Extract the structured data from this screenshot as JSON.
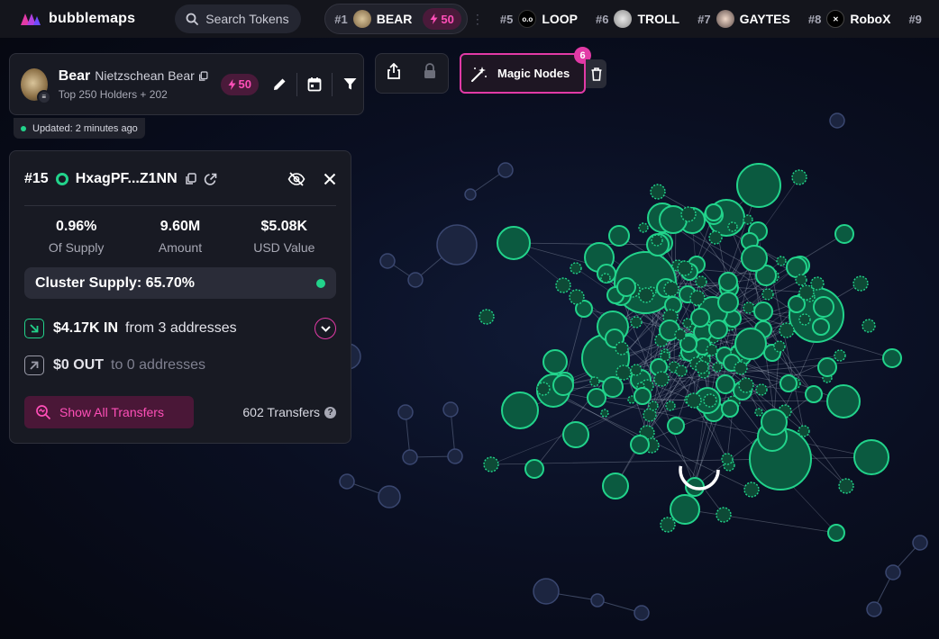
{
  "app": {
    "brand_name": "bubblemaps",
    "accent_color": "#e23aa6",
    "node_color": "#22d38b"
  },
  "search": {
    "label": "Search Tokens",
    "icon": "search-icon"
  },
  "tokens": [
    {
      "rank": "#1",
      "name": "BEAR",
      "bolt": "50",
      "active": true
    },
    {
      "rank": "#5",
      "name": "LOOP"
    },
    {
      "rank": "#6",
      "name": "TROLL"
    },
    {
      "rank": "#7",
      "name": "GAYTES"
    },
    {
      "rank": "#8",
      "name": "RoboX"
    },
    {
      "rank": "#9",
      "name": ""
    }
  ],
  "token_card": {
    "name": "Bear",
    "full_name": "Nietzschean Bear",
    "subtitle": "Top 250 Holders + 202",
    "bolt": "50",
    "updated": "Updated: 2 minutes ago"
  },
  "magic": {
    "label": "Magic Nodes",
    "count": "6"
  },
  "panel": {
    "rank": "#15",
    "address": "HxagPF...Z1NN",
    "stats": [
      {
        "value": "0.96%",
        "label": "Of Supply"
      },
      {
        "value": "9.60M",
        "label": "Amount"
      },
      {
        "value": "$5.08K",
        "label": "USD Value"
      }
    ],
    "cluster_supply": "Cluster Supply: 65.70%",
    "inflow": {
      "amount": "$4.17K IN",
      "desc": "from 3 addresses"
    },
    "outflow": {
      "amount": "$0 OUT",
      "desc": "to 0 addresses"
    },
    "show_all_label": "Show All Transfers",
    "transfers_count": "602 Transfers"
  }
}
